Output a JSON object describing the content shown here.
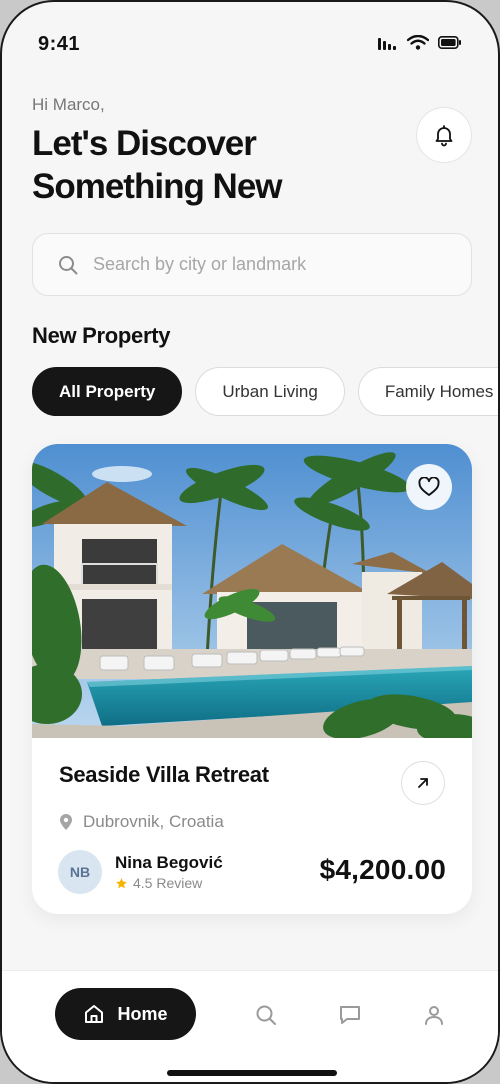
{
  "status_bar": {
    "time": "9:41"
  },
  "header": {
    "greeting": "Hi Marco,",
    "headline": "Let's Discover Something New"
  },
  "search": {
    "placeholder": "Search by city or landmark"
  },
  "section": {
    "title": "New Property"
  },
  "filters": [
    {
      "label": "All Property",
      "active": true
    },
    {
      "label": "Urban Living",
      "active": false
    },
    {
      "label": "Family Homes",
      "active": false
    }
  ],
  "property": {
    "name": "Seaside Villa Retreat",
    "location": "Dubrovnik, Croatia",
    "agent": {
      "initials": "NB",
      "name": "Nina Begović",
      "rating": "4.5 Review"
    },
    "price": "$4,200.00"
  },
  "bottom_nav": {
    "home_label": "Home",
    "items": [
      "home",
      "search",
      "messages",
      "profile"
    ]
  },
  "colors": {
    "accent": "#161616",
    "star": "#f5b400",
    "background": "#f6f6f6"
  }
}
